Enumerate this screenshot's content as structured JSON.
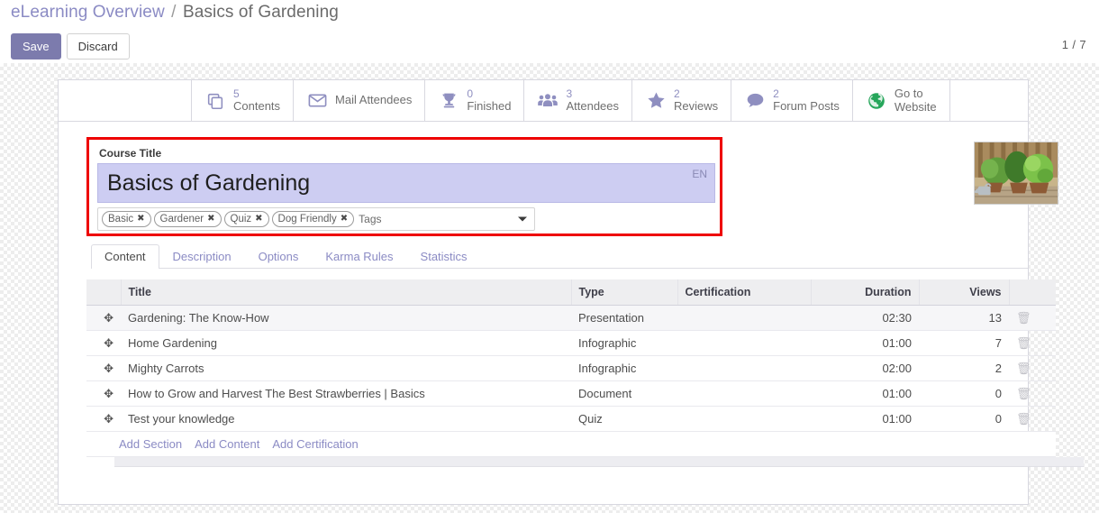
{
  "breadcrumb": {
    "parent": "eLearning Overview",
    "separator": "/",
    "current": "Basics of Gardening"
  },
  "controlpanel": {
    "save_label": "Save",
    "discard_label": "Discard",
    "pager": "1 / 7"
  },
  "stat_buttons": [
    {
      "icon": "copy-icon",
      "value": "5",
      "label": "Contents",
      "label2": ""
    },
    {
      "icon": "envelope-icon",
      "value": "",
      "label": "Mail Attendees",
      "label2": ""
    },
    {
      "icon": "trophy-icon",
      "value": "0",
      "label": "Finished",
      "label2": ""
    },
    {
      "icon": "users-icon",
      "value": "3",
      "label": "Attendees",
      "label2": ""
    },
    {
      "icon": "star-icon",
      "value": "2",
      "label": "Reviews",
      "label2": ""
    },
    {
      "icon": "comment-icon",
      "value": "2",
      "label": "Forum Posts",
      "label2": ""
    },
    {
      "icon": "globe-icon",
      "value": "",
      "label": "Go to",
      "label2": "Website"
    }
  ],
  "form": {
    "course_title_label": "Course Title",
    "course_title_value": "Basics of Gardening",
    "lang_badge": "EN",
    "tags_placeholder": "Tags",
    "tags": [
      "Basic",
      "Gardener",
      "Quiz",
      "Dog Friendly"
    ],
    "chip_remove_glyph": "✖"
  },
  "tabs": [
    {
      "label": "Content",
      "active": true
    },
    {
      "label": "Description",
      "active": false
    },
    {
      "label": "Options",
      "active": false
    },
    {
      "label": "Karma Rules",
      "active": false
    },
    {
      "label": "Statistics",
      "active": false
    }
  ],
  "table": {
    "columns": [
      "",
      "Title",
      "Type",
      "Certification",
      "Duration",
      "Views",
      ""
    ],
    "rows": [
      {
        "title": "Gardening: The Know-How",
        "type": "Presentation",
        "certification": "",
        "duration": "02:30",
        "views": "13"
      },
      {
        "title": "Home Gardening",
        "type": "Infographic",
        "certification": "",
        "duration": "01:00",
        "views": "7"
      },
      {
        "title": "Mighty Carrots",
        "type": "Infographic",
        "certification": "",
        "duration": "02:00",
        "views": "2"
      },
      {
        "title": "How to Grow and Harvest The Best Strawberries | Basics",
        "type": "Document",
        "certification": "",
        "duration": "01:00",
        "views": "0"
      },
      {
        "title": "Test your knowledge",
        "type": "Quiz",
        "certification": "",
        "duration": "01:00",
        "views": "0"
      }
    ],
    "add_links": [
      "Add Section",
      "Add Content",
      "Add Certification"
    ],
    "drag_glyph": "✥",
    "trash_glyph": "🗑"
  },
  "colors": {
    "brand_purple": "#7c7bad",
    "link_purple": "#8b8bc4",
    "highlight_red": "#ee0000",
    "title_field_bg": "#cdcdf2",
    "header_bg": "#eeeef0",
    "website_green": "#26a65b"
  }
}
